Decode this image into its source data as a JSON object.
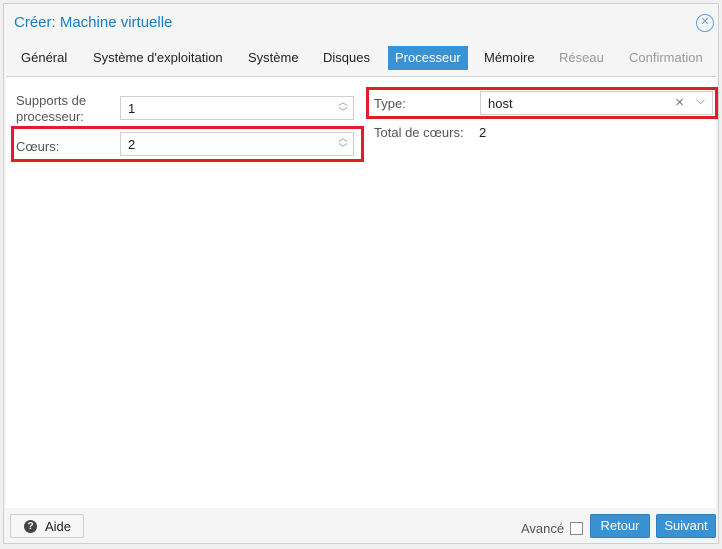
{
  "dialog": {
    "title": "Créer: Machine virtuelle"
  },
  "tabs": [
    {
      "label": "Général",
      "state": "normal"
    },
    {
      "label": "Système d'exploitation",
      "state": "normal"
    },
    {
      "label": "Système",
      "state": "normal"
    },
    {
      "label": "Disques",
      "state": "normal"
    },
    {
      "label": "Processeur",
      "state": "active"
    },
    {
      "label": "Mémoire",
      "state": "normal"
    },
    {
      "label": "Réseau",
      "state": "disabled"
    },
    {
      "label": "Confirmation",
      "state": "disabled"
    }
  ],
  "form": {
    "sockets_label_line1": "Supports de",
    "sockets_label_line2": "processeur:",
    "sockets_value": "1",
    "cores_label": "Cœurs:",
    "cores_value": "2",
    "type_label": "Type:",
    "type_value": "host",
    "total_cores_label": "Total de cœurs:",
    "total_cores_value": "2"
  },
  "footer": {
    "help_label": "Aide",
    "advanced_label": "Avancé",
    "advanced_checked": false,
    "back_label": "Retour",
    "next_label": "Suivant"
  },
  "colors": {
    "accent": "#3892d4",
    "title": "#157fcc",
    "highlight": "#e01e2a"
  },
  "icons": {
    "close": "close-circle-icon",
    "help": "question-circle-icon",
    "spinner": "spinner-icon",
    "clear": "clear-x-icon",
    "dropdown": "chevron-down-icon"
  }
}
